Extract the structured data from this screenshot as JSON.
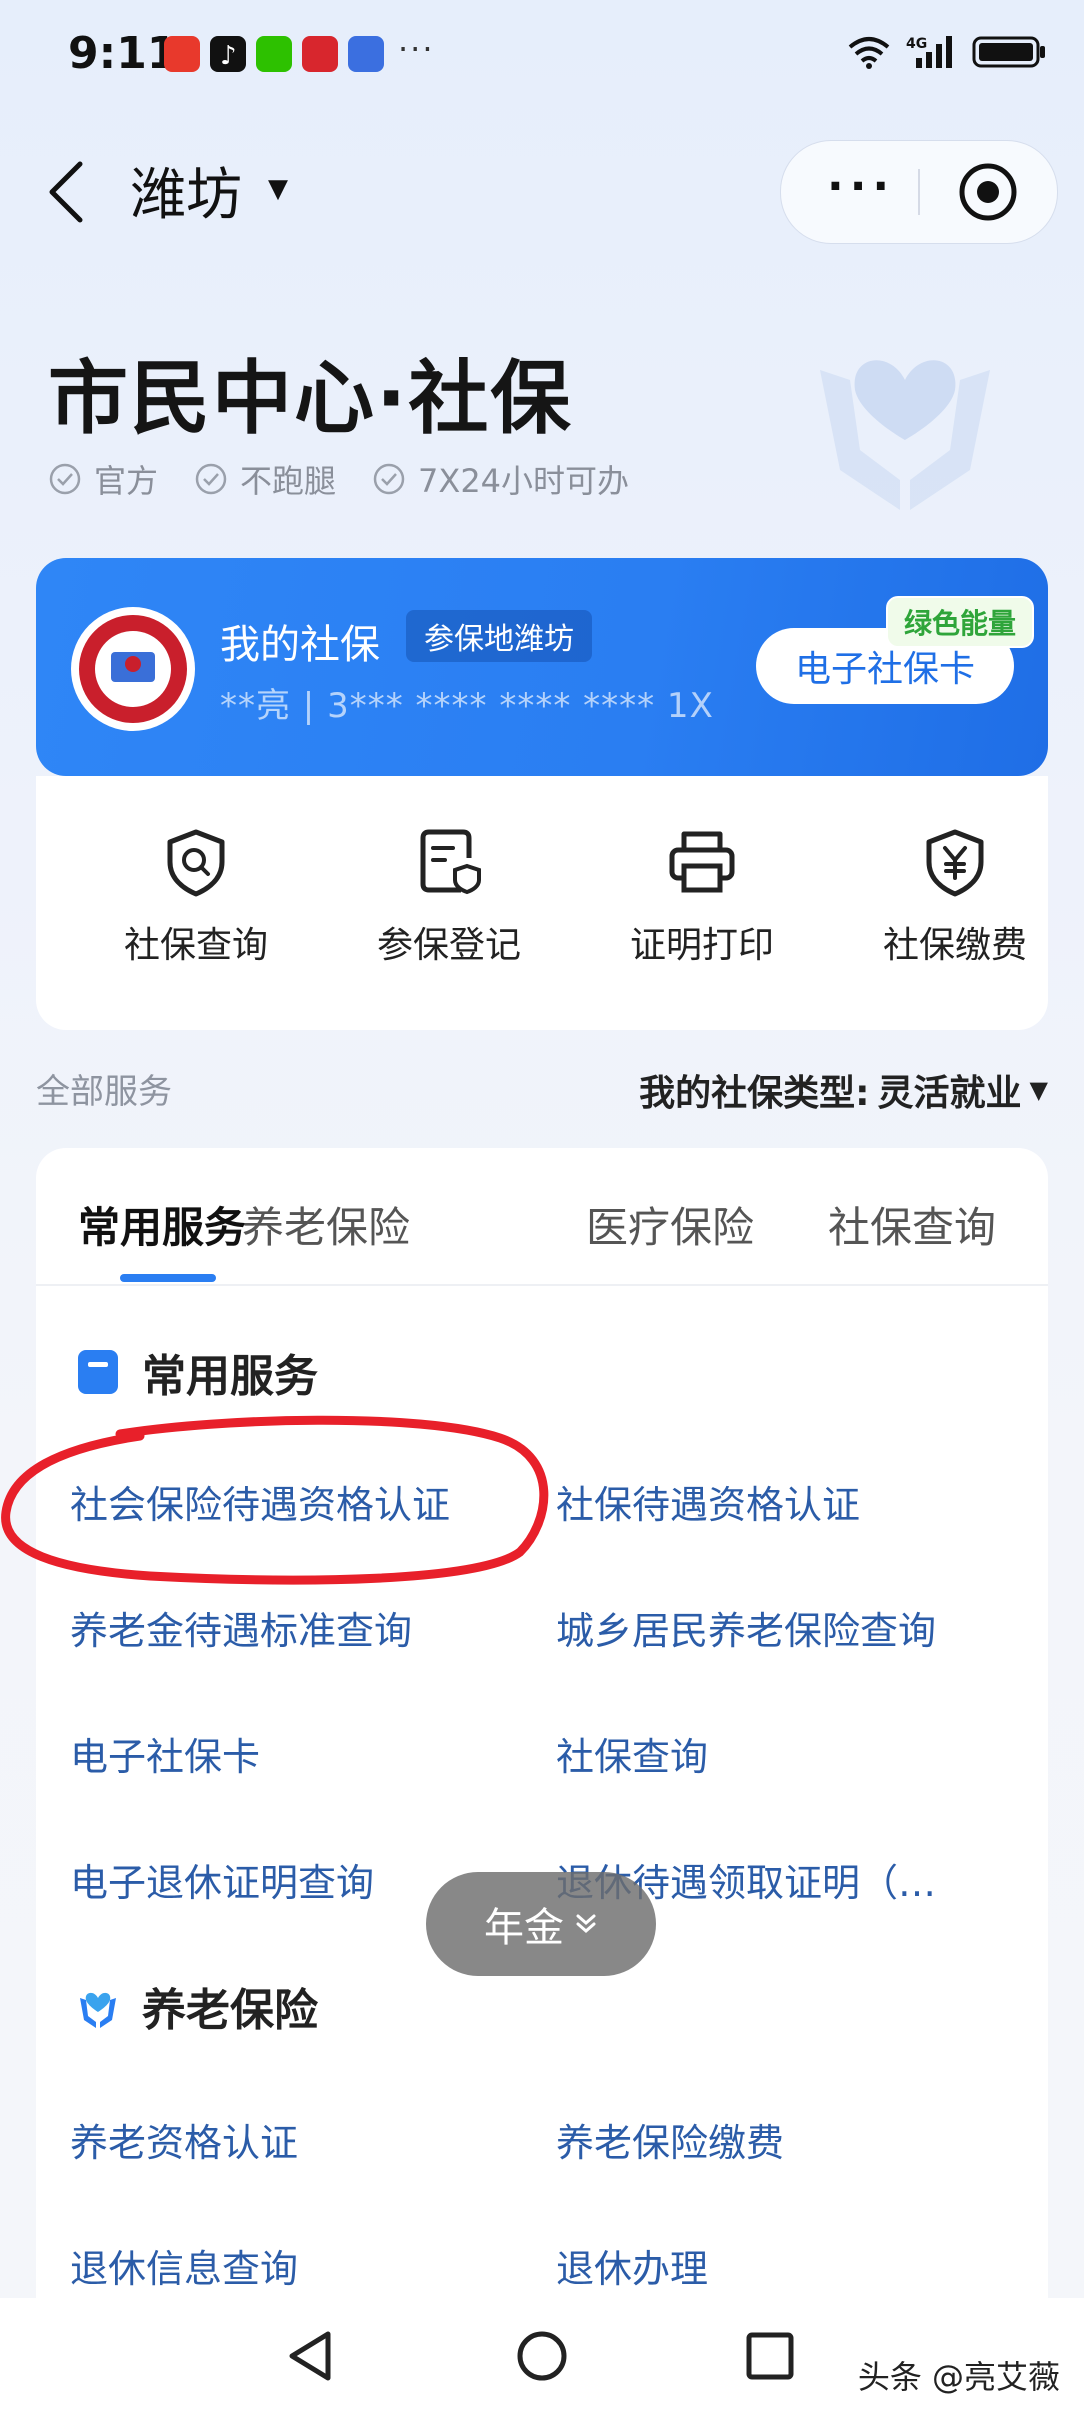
{
  "status_bar": {
    "time": "9:11",
    "more": "···"
  },
  "nav": {
    "city": "潍坊"
  },
  "header": {
    "title": "市民中心·社保",
    "tags": [
      "官方",
      "不跑腿",
      "7X24小时可办"
    ]
  },
  "card": {
    "title": "我的社保",
    "location": "参保地潍坊",
    "number": "**亮 | 3*** **** **** **** 1X",
    "ecard": "电子社保卡",
    "green": "绿色能量"
  },
  "quick": [
    "社保查询",
    "参保登记",
    "证明打印",
    "社保缴费"
  ],
  "all_services": "全部服务",
  "type_label": "我的社保类型:",
  "type_value": "灵活就业",
  "tabs": [
    "常用服务",
    "养老保险",
    "医疗保险",
    "社保查询"
  ],
  "sections": [
    {
      "title": "常用服务",
      "items": [
        "社会保险待遇资格认证",
        "社保待遇资格认证",
        "养老金待遇标准查询",
        "城乡居民养老保险查询",
        "电子社保卡",
        "社保查询",
        "电子退休证明查询",
        "退休待遇领取证明（…"
      ]
    },
    {
      "title": "养老保险",
      "items": [
        "养老资格认证",
        "养老保险缴费",
        "退休信息查询",
        "退休办理"
      ]
    }
  ],
  "float_button": "年金",
  "watermark": "头条 @亮艾薇",
  "colors": {
    "primary": "#2a7ef2",
    "link": "#2b5ca8",
    "annotation": "#e8202a"
  }
}
